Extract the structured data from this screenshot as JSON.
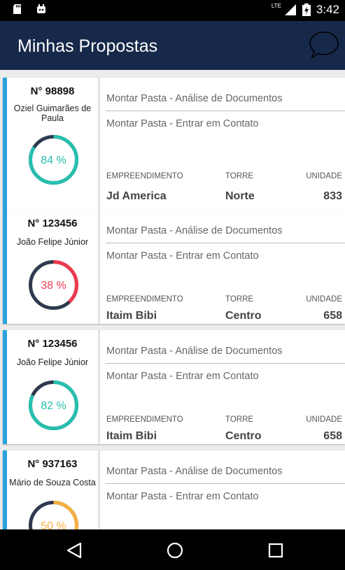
{
  "status_bar": {
    "time": "3:42",
    "network": "LTE"
  },
  "app_bar": {
    "title": "Minhas Propostas"
  },
  "labels": {
    "empreendimento": "EMPREENDIMENTO",
    "torre": "TORRE",
    "unidade": "UNIDADE"
  },
  "cards": [
    {
      "number": "N° 98898",
      "client": "Oziel Guimarães de Paula",
      "percent_label": "84 %",
      "percent": 84,
      "color": "#26bfae",
      "task1": "Montar Pasta - Análise de Documentos",
      "task2": "Montar Pasta - Entrar em Contato",
      "empreendimento": "Jd America",
      "torre": "Norte",
      "unidade": "833"
    },
    {
      "number": "N° 123456",
      "client": "João Felipe Júnior",
      "percent_label": "38 %",
      "percent": 38,
      "color": "#ee3a4e",
      "task1": "Montar Pasta - Análise de Documentos",
      "task2": "Montar Pasta - Entrar em Contato",
      "empreendimento": "Itaim Bibi",
      "torre": "Centro",
      "unidade": "658"
    },
    {
      "number": "N° 123456",
      "client": "João Felipe Júnior",
      "percent_label": "82 %",
      "percent": 82,
      "color": "#26bfae",
      "task1": "Montar Pasta - Análise de Documentos",
      "task2": "Montar Pasta - Entrar em Contato",
      "empreendimento": "Itaim Bibi",
      "torre": "Centro",
      "unidade": "658"
    },
    {
      "number": "N° 937163",
      "client": "Mário de Souza Costa",
      "percent_label": "50 %",
      "percent": 50,
      "color": "#f5b041",
      "task1": "Montar Pasta - Análise de Documentos",
      "task2": "Montar Pasta - Entrar em Contato",
      "empreendimento": "",
      "torre": "",
      "unidade": ""
    }
  ],
  "colors": {
    "ring_track": "#2e3a4d",
    "accent_bar": "#29a3dc",
    "app_bar": "#17294a"
  },
  "nav_icons": [
    "back-icon",
    "home-icon",
    "recents-icon"
  ]
}
